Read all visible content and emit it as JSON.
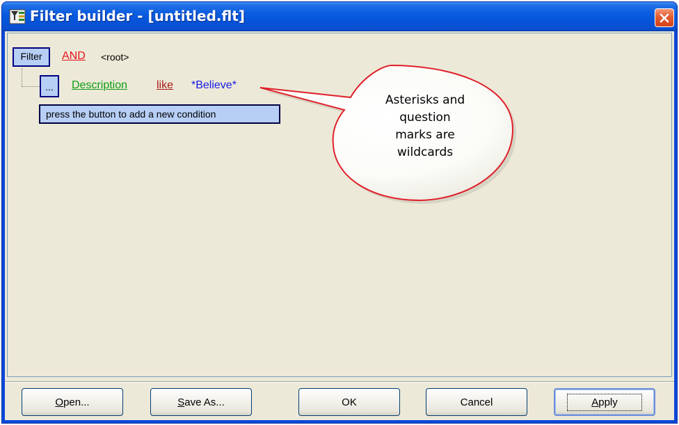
{
  "window": {
    "title": "Filter builder - [untitled.flt]",
    "accent": "#0a5ce0"
  },
  "tree": {
    "root_button": "Filter",
    "root_operator": "AND",
    "root_label": "<root>",
    "condition": {
      "button": "...",
      "field": "Description",
      "operator": "like",
      "value": "*Believe*"
    },
    "hint": "press the button to add a new condition"
  },
  "callout": {
    "lines": [
      "Asterisks and",
      "question",
      "marks are",
      "wildcards"
    ]
  },
  "buttons": {
    "open": {
      "mnemonic": "O",
      "rest": "pen..."
    },
    "save_as": {
      "mnemonic": "S",
      "rest": "ave As..."
    },
    "ok": "OK",
    "cancel": "Cancel",
    "apply": {
      "mnemonic": "A",
      "rest": "pply"
    }
  },
  "colors": {
    "operator_and": "#e8141c",
    "field": "#139c13",
    "comparison": "#a81818",
    "value": "#1a1ae8",
    "selection_fill": "#b7cff5"
  }
}
